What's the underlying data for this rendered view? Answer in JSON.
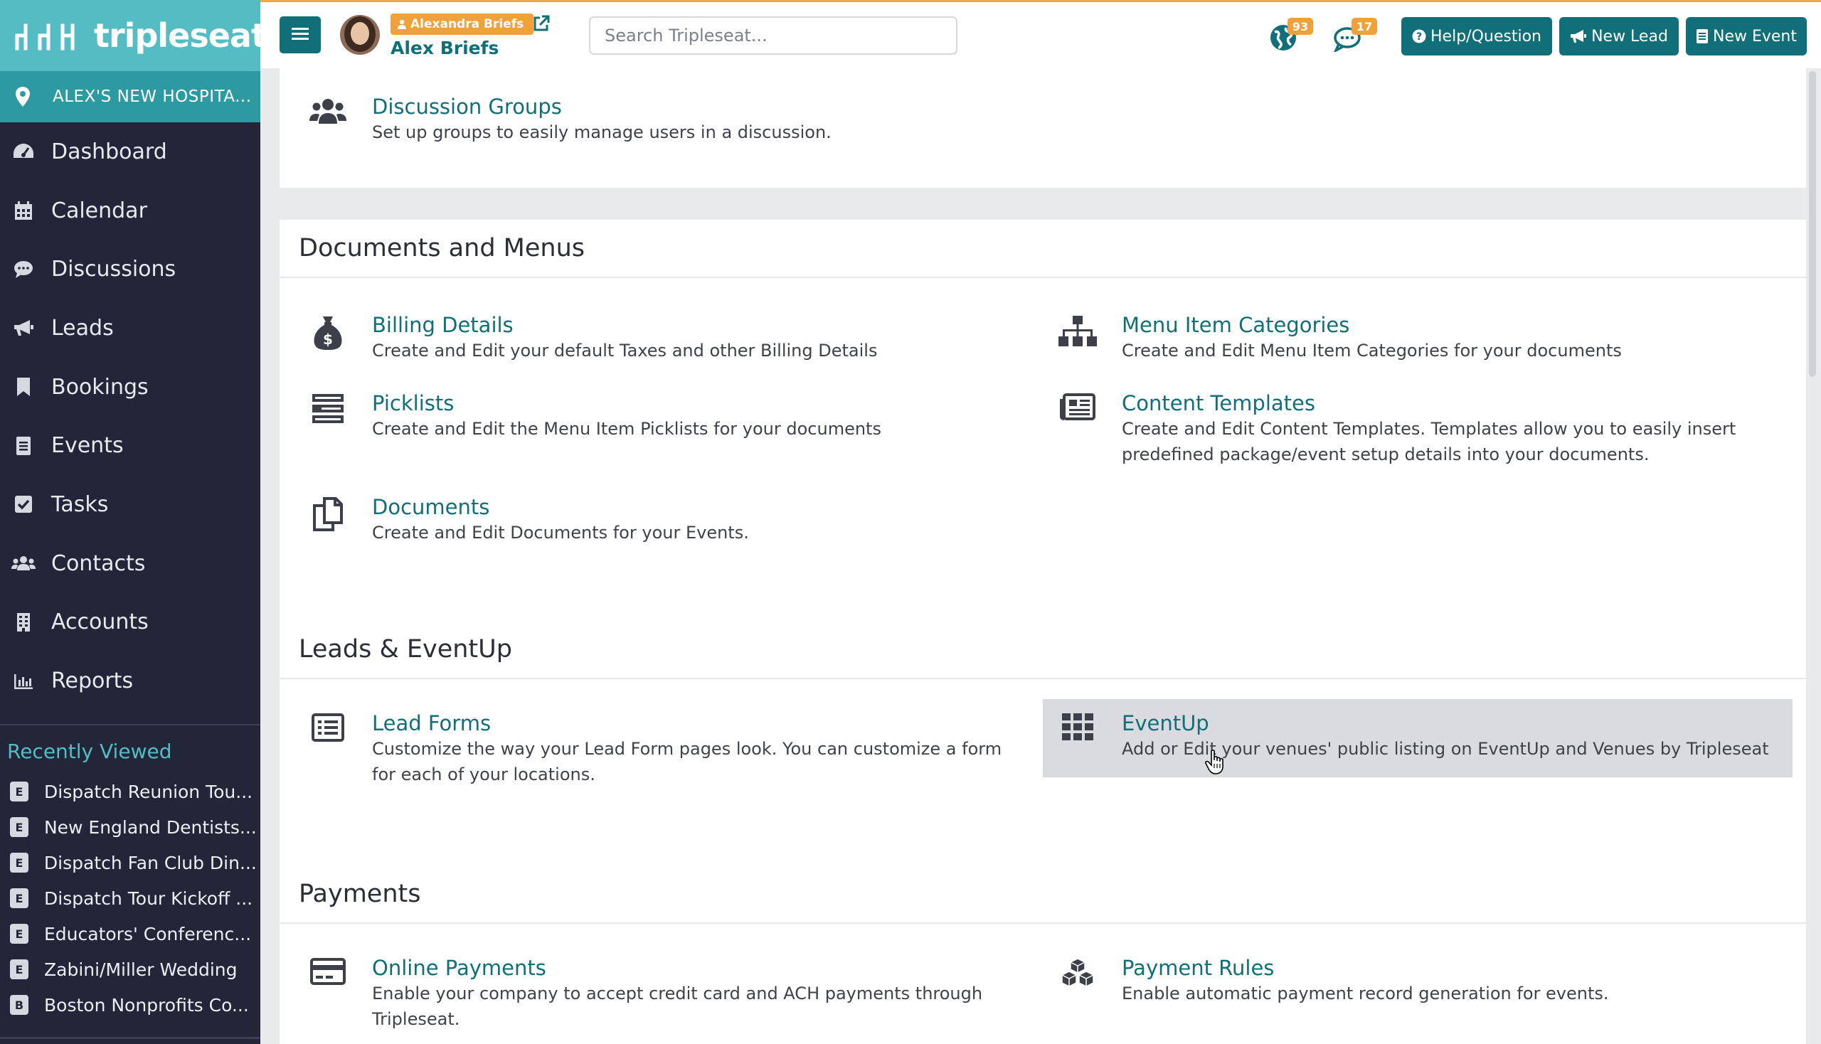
{
  "app": {
    "logo_text": "tripleseat",
    "location": "ALEX'S NEW HOSPITA..."
  },
  "sidebar": {
    "nav": [
      {
        "label": "Dashboard",
        "icon": "dashboard-icon"
      },
      {
        "label": "Calendar",
        "icon": "calendar-icon"
      },
      {
        "label": "Discussions",
        "icon": "chat-bubble-icon"
      },
      {
        "label": "Leads",
        "icon": "megaphone-icon"
      },
      {
        "label": "Bookings",
        "icon": "bookmark-icon"
      },
      {
        "label": "Events",
        "icon": "document-icon"
      },
      {
        "label": "Tasks",
        "icon": "checkbox-icon"
      },
      {
        "label": "Contacts",
        "icon": "users-icon"
      },
      {
        "label": "Accounts",
        "icon": "building-icon"
      },
      {
        "label": "Reports",
        "icon": "bar-chart-icon"
      }
    ],
    "recent_title": "Recently Viewed",
    "recent": [
      {
        "badge": "E",
        "label": "Dispatch Reunion Tou..."
      },
      {
        "badge": "E",
        "label": "New England Dentists..."
      },
      {
        "badge": "E",
        "label": "Dispatch Fan Club Din..."
      },
      {
        "badge": "E",
        "label": "Dispatch Tour Kickoff ..."
      },
      {
        "badge": "E",
        "label": "Educators' Conferenc..."
      },
      {
        "badge": "E",
        "label": "Zabini/Miller Wedding"
      },
      {
        "badge": "B",
        "label": "Boston Nonprofits Co..."
      }
    ]
  },
  "topbar": {
    "impersonate_label": "Alexandra Briefs",
    "user_name": "Alex Briefs",
    "search_placeholder": "Search Tripleseat...",
    "notifications": {
      "globe_count": "93",
      "chat_count": "17"
    },
    "help_label": "Help/Question",
    "new_lead_label": "New Lead",
    "new_event_label": "New Event"
  },
  "sections": {
    "top": {
      "items": [
        {
          "title": "Discussion Groups",
          "desc": "Set up groups to easily manage users in a discussion.",
          "icon": "users-group-icon"
        }
      ]
    },
    "documents": {
      "title": "Documents and Menus",
      "items": [
        {
          "title": "Billing Details",
          "desc": "Create and Edit your default Taxes and other Billing Details",
          "icon": "money-bag-icon"
        },
        {
          "title": "Menu Item Categories",
          "desc": "Create and Edit Menu Item Categories for your documents",
          "icon": "sitemap-icon"
        },
        {
          "title": "Picklists",
          "desc": "Create and Edit the Menu Item Picklists for your documents",
          "icon": "list-stack-icon"
        },
        {
          "title": "Content Templates",
          "desc": "Create and Edit Content Templates. Templates allow you to easily insert predefined package/event setup details into your documents.",
          "icon": "newspaper-icon"
        },
        {
          "title": "Documents",
          "desc": "Create and Edit Documents for your Events.",
          "icon": "copy-documents-icon"
        }
      ]
    },
    "leads": {
      "title": "Leads & EventUp",
      "items": [
        {
          "title": "Lead Forms",
          "desc": "Customize the way your Lead Form pages look. You can customize a form for each of your locations.",
          "icon": "list-form-icon"
        },
        {
          "title": "EventUp",
          "desc": "Add or Edit your venues' public listing on EventUp and Venues by Tripleseat",
          "icon": "grid-icon"
        }
      ]
    },
    "payments": {
      "title": "Payments",
      "items": [
        {
          "title": "Online Payments",
          "desc": "Enable your company to accept credit card and ACH payments through Tripleseat.",
          "icon": "credit-card-icon"
        },
        {
          "title": "Payment Rules",
          "desc": "Enable automatic payment record generation for events.",
          "icon": "cubes-icon"
        }
      ]
    }
  },
  "colors": {
    "sidebar_bg": "#232638",
    "logo_bg": "#54bdc4",
    "location_bg": "#2d9aa2",
    "accent": "#116f7a",
    "badge_orange": "#f0a13c"
  }
}
